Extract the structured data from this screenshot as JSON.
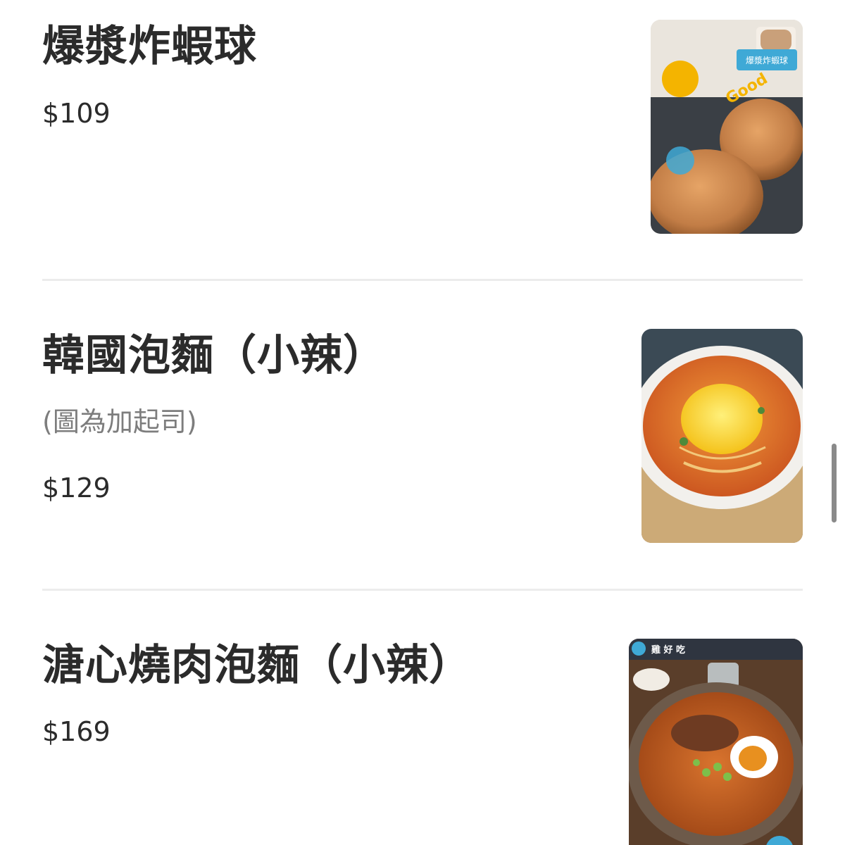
{
  "menu": {
    "items": [
      {
        "name": "爆漿炸蝦球",
        "description": "",
        "price": "$109",
        "image_overlay": {
          "title": "爆漿炸蝦球",
          "tag": "Good",
          "label": "爆漿炸蝦球"
        }
      },
      {
        "name": "韓國泡麵（小辣）",
        "description": "(圖為加起司)",
        "price": "$129"
      },
      {
        "name": "溏心燒肉泡麵（小辣）",
        "description": "",
        "price": "$169",
        "image_overlay": {
          "brand": "雞 好 吃"
        }
      }
    ]
  },
  "colors": {
    "text": "#2b2b2b",
    "secondary_text": "#7d7d7d",
    "divider": "#ececec",
    "overlay_accent": "#3fa9d6",
    "badge_yellow": "#f4b400"
  }
}
